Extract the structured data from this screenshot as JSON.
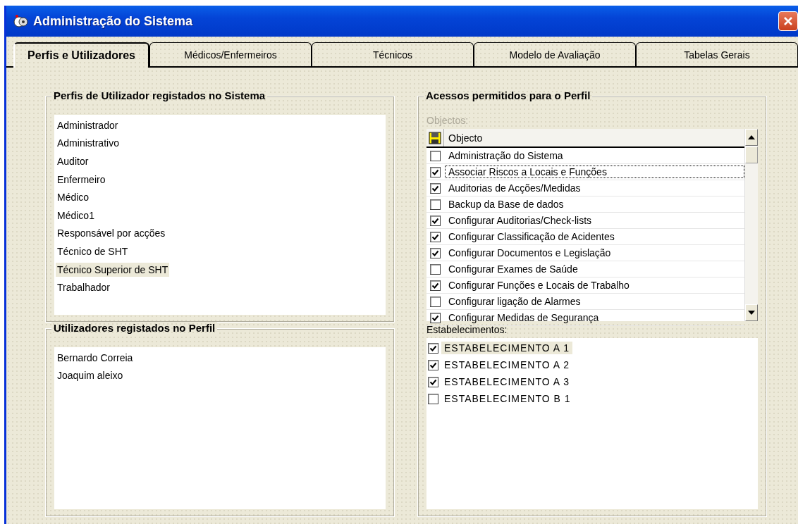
{
  "window": {
    "title": "Administração do Sistema"
  },
  "tabs": [
    {
      "label": "Perfis e Utilizadores",
      "selected": true
    },
    {
      "label": "Médicos/Enfermeiros",
      "selected": false
    },
    {
      "label": "Técnicos",
      "selected": false
    },
    {
      "label": "Modelo de Avaliação",
      "selected": false
    },
    {
      "label": "Tabelas Gerais",
      "selected": false
    }
  ],
  "profiles": {
    "title": "Perfis de Utilizador registados no Sistema",
    "items": [
      {
        "label": "Administrador",
        "selected": false
      },
      {
        "label": "Administrativo",
        "selected": false
      },
      {
        "label": "Auditor",
        "selected": false
      },
      {
        "label": "Enfermeiro",
        "selected": false
      },
      {
        "label": "Médico",
        "selected": false
      },
      {
        "label": "Médico1",
        "selected": false
      },
      {
        "label": "Responsável por acções",
        "selected": false
      },
      {
        "label": "Técnico de SHT",
        "selected": false
      },
      {
        "label": "Técnico Superior de SHT",
        "selected": true
      },
      {
        "label": "Trabalhador",
        "selected": false
      }
    ]
  },
  "users": {
    "title": "Utilizadores registados no Perfil",
    "items": [
      "Bernardo Correia",
      "Joaquim aleixo"
    ]
  },
  "access": {
    "title": "Acessos permitidos para o Perfil",
    "objects_label": "Objectos:",
    "column": "Objecto",
    "rows": [
      {
        "label": "Administração do Sistema",
        "checked": false,
        "selected": false
      },
      {
        "label": "Associar Riscos a Locais e Funções",
        "checked": true,
        "selected": true
      },
      {
        "label": "Auditorias de Acções/Medidas",
        "checked": true,
        "selected": false
      },
      {
        "label": "Backup da Base de dados",
        "checked": false,
        "selected": false
      },
      {
        "label": "Configurar Auditorias/Check-lists",
        "checked": true,
        "selected": false
      },
      {
        "label": "Configurar Classificação de Acidentes",
        "checked": true,
        "selected": false
      },
      {
        "label": "Configurar Documentos e Legislação",
        "checked": true,
        "selected": false
      },
      {
        "label": "Configurar Exames de Saúde",
        "checked": false,
        "selected": false
      },
      {
        "label": "Configurar Funções e Locais de Trabalho",
        "checked": true,
        "selected": false
      },
      {
        "label": "Configurar ligação de Alarmes",
        "checked": false,
        "selected": false
      },
      {
        "label": "Configurar Medidas de Segurança",
        "checked": true,
        "selected": false
      }
    ],
    "establishments_label": "Estabelecimentos:",
    "establishments": [
      {
        "label": "ESTABELECIMENTO A 1",
        "checked": true,
        "selected": true
      },
      {
        "label": "ESTABELECIMENTO A 2",
        "checked": true,
        "selected": false
      },
      {
        "label": "ESTABELECIMENTO A 3",
        "checked": true,
        "selected": false
      },
      {
        "label": "ESTABELECIMENTO B 1",
        "checked": false,
        "selected": false
      }
    ]
  }
}
